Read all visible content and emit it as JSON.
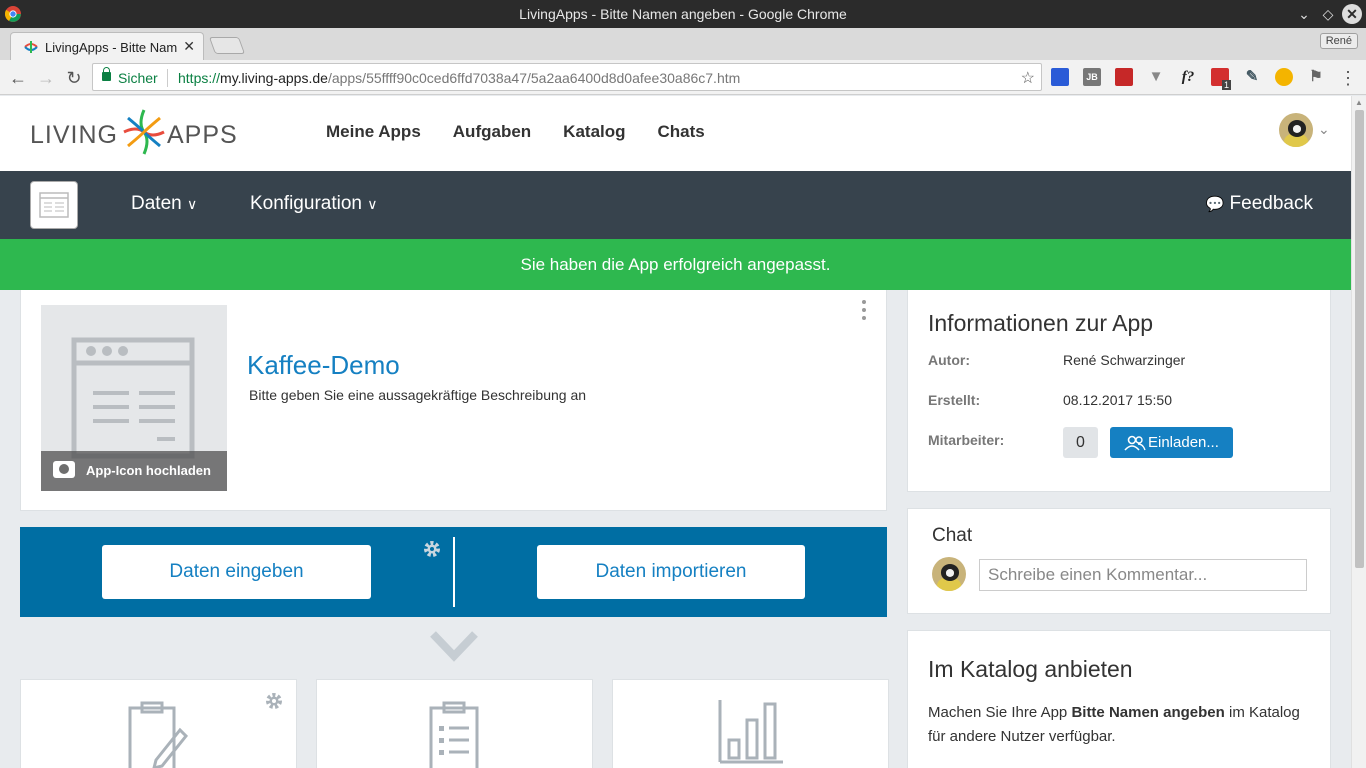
{
  "window": {
    "title": "LivingApps - Bitte Namen angeben - Google Chrome"
  },
  "browser": {
    "tab_title": "LivingApps - Bitte Namen angeben",
    "profile_name": "René",
    "secure_label": "Sicher",
    "url_scheme": "https://",
    "url_host": "my.living-apps.de",
    "url_path": "/apps/55ffff90c0ced6ffd7038a47/5a2aa6400d8d0afee30a86c7.htm",
    "extensions": [
      "extension-blue",
      "JB",
      "extension-red",
      "extension-v",
      "f?",
      "extension-notify",
      "extension-pen",
      "extension-chrome",
      "extension-flag"
    ],
    "extension_badge": "1"
  },
  "topnav": {
    "logo_left": "LIVING",
    "logo_right": "APPS",
    "items": [
      "Meine Apps",
      "Aufgaben",
      "Katalog",
      "Chats"
    ]
  },
  "appbar": {
    "menu_data": "Daten",
    "menu_config": "Konfiguration",
    "feedback": "Feedback"
  },
  "banner": {
    "text": "Sie haben die App erfolgreich angepasst."
  },
  "app": {
    "title": "Kaffee-Demo",
    "description": "Bitte geben Sie eine aussagekräftige Beschreibung an",
    "upload_label": "App-Icon hochladen"
  },
  "actions": {
    "enter_data": "Daten eingeben",
    "import_data": "Daten importieren"
  },
  "info": {
    "heading": "Informationen zur App",
    "author_label": "Autor:",
    "author_value": "René Schwarzinger",
    "created_label": "Erstellt:",
    "created_value": "08.12.2017 15:50",
    "staff_label": "Mitarbeiter:",
    "staff_count": "0",
    "invite_label": "Einladen..."
  },
  "chat": {
    "heading": "Chat",
    "placeholder": "Schreibe einen Kommentar..."
  },
  "katalog": {
    "heading": "Im Katalog anbieten",
    "text_before": "Machen Sie Ihre App ",
    "text_bold": "Bitte Namen angeben",
    "text_after": " im Katalog für andere Nutzer verfügbar."
  },
  "colors": {
    "accent_blue": "#1580c2",
    "bar_blue": "#006ea3",
    "success_green": "#2eb84f",
    "appbar_dark": "#37434d"
  }
}
